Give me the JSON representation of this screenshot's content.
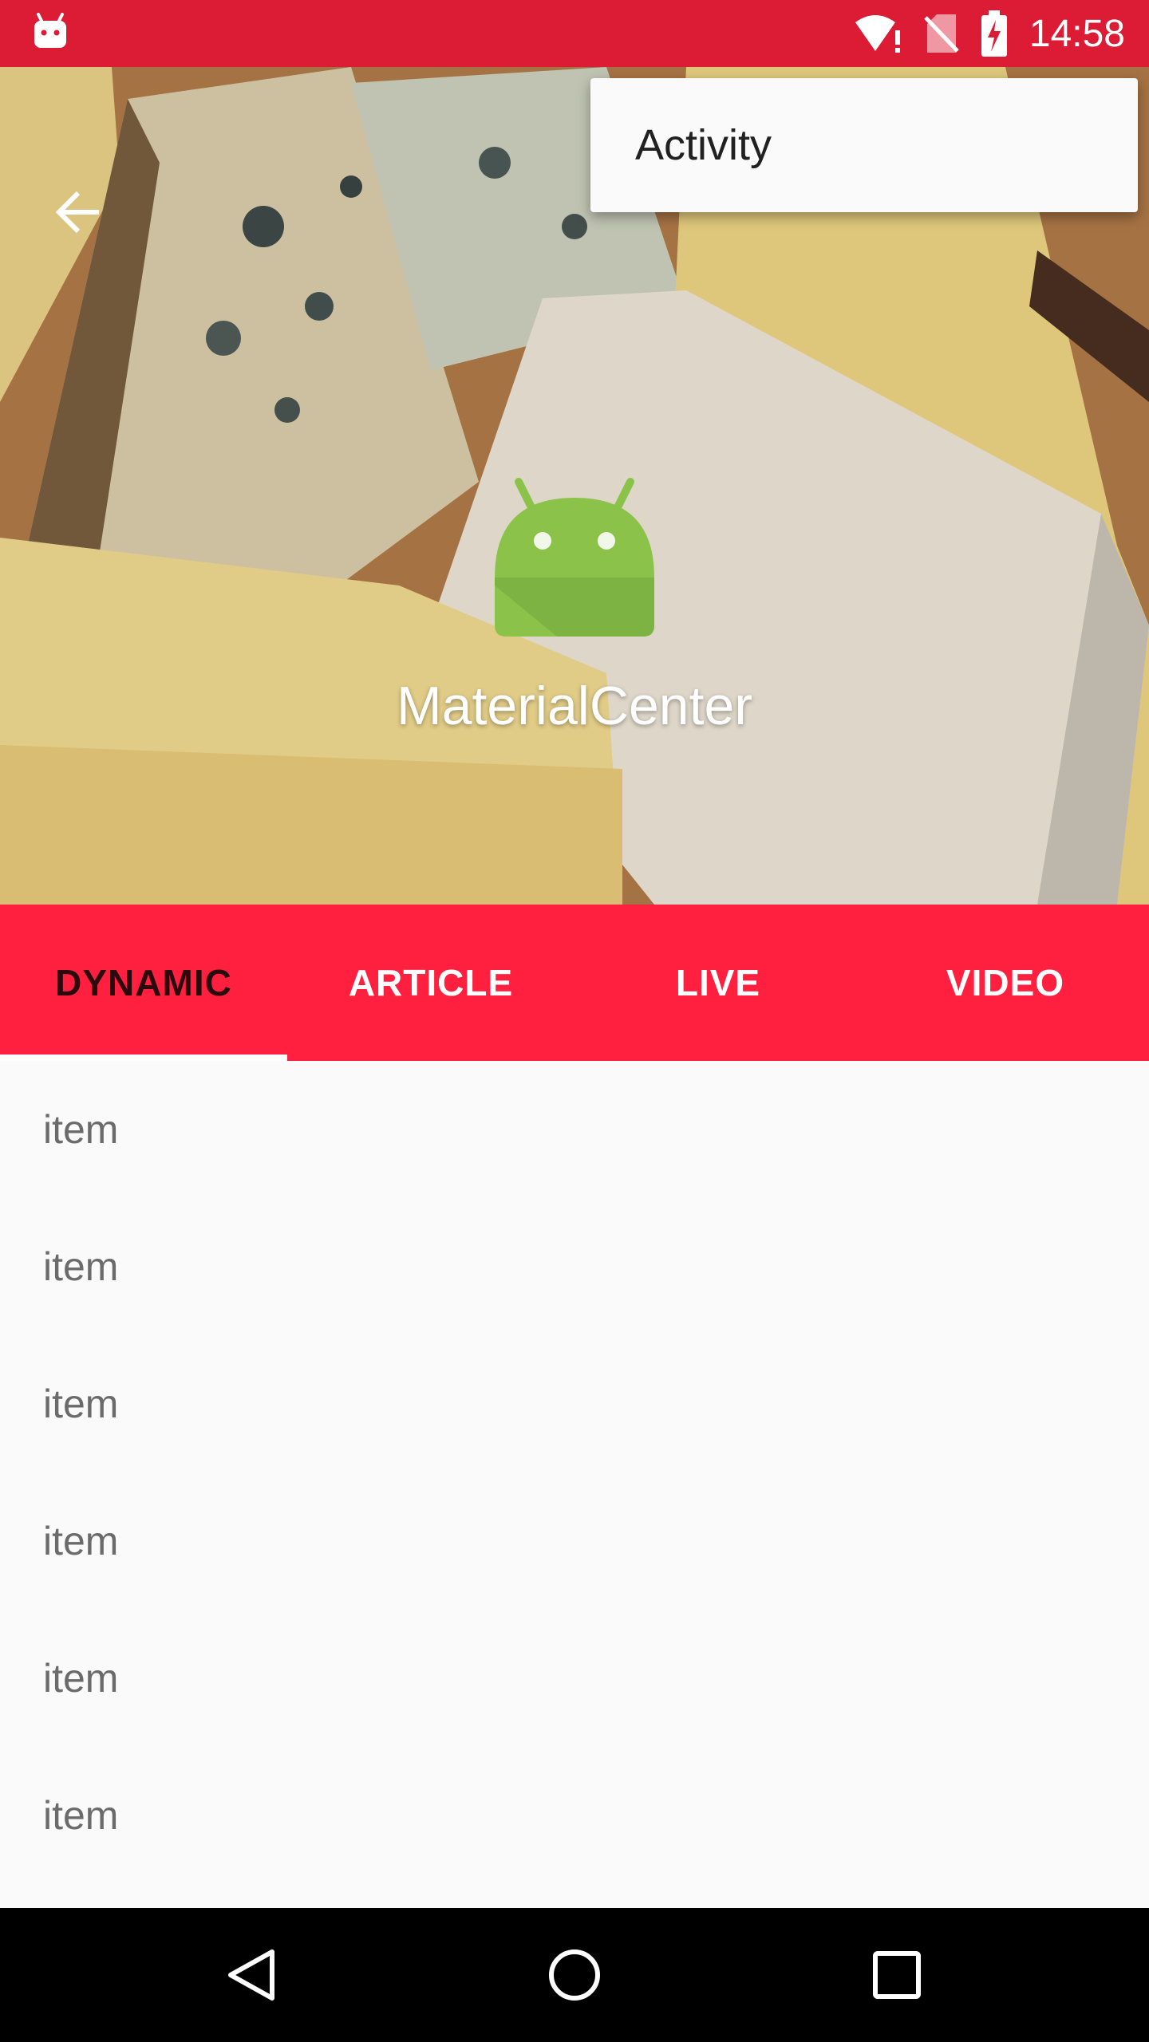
{
  "status_bar": {
    "time": "14:58",
    "icons": [
      "android-notification-icon",
      "wifi-alert-icon",
      "no-sim-icon",
      "battery-charging-icon"
    ]
  },
  "header": {
    "app_name": "MaterialCenter",
    "back_icon": "arrow-back-icon",
    "logo_icon": "android-logo-icon"
  },
  "menu": {
    "items": [
      {
        "label": "Activity"
      }
    ]
  },
  "tabs": {
    "items": [
      {
        "label": "DYNAMIC",
        "active": true
      },
      {
        "label": "ARTICLE",
        "active": false
      },
      {
        "label": "LIVE",
        "active": false
      },
      {
        "label": "VIDEO",
        "active": false
      }
    ]
  },
  "list": {
    "items": [
      {
        "label": "item"
      },
      {
        "label": "item"
      },
      {
        "label": "item"
      },
      {
        "label": "item"
      },
      {
        "label": "item"
      },
      {
        "label": "item"
      }
    ]
  },
  "nav_bar": {
    "icons": [
      "back-triangle-icon",
      "home-circle-icon",
      "recents-square-icon"
    ]
  },
  "colors": {
    "status_bar": "#dc1b35",
    "tab_bar": "#ff1f3f",
    "active_tab_text": "#2b0a0f",
    "list_text": "#6b6b6b"
  }
}
